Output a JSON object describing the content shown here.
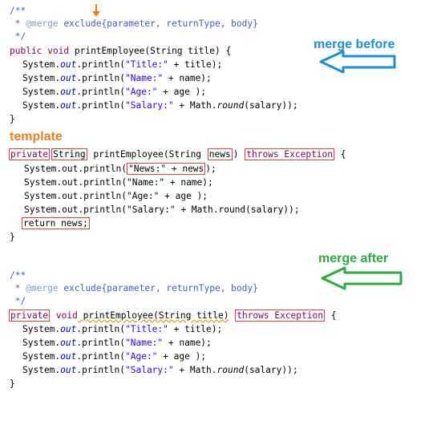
{
  "labels": {
    "merge_before": "merge before",
    "template": "template",
    "merge_after": "merge after"
  },
  "colors": {
    "merge_before": "#1a8fd8",
    "template": "#f07e1a",
    "merge_after": "#2aaa40",
    "box": "#d84040"
  },
  "block1": {
    "doc_open": "/**",
    "doc_line_star": " * ",
    "doc_tag": "@merge",
    "doc_text": " exclude{parameter, returnType, body}",
    "doc_close": " */",
    "sig_public": "public",
    "sig_void": "void",
    "sig_rest": " printEmployee(String title) {",
    "l1_a": "System.",
    "l1_out": "out",
    "l1_b": ".println(",
    "l1_str": "\"Title:\"",
    "l1_c": " + title);",
    "l2_str": "\"Name:\"",
    "l2_c": " + name);",
    "l3_str": "\"Age:\"",
    "l3_c": " + age );",
    "l4_str": "\"Salary:\"",
    "l4_c": " + Math.",
    "l4_round": "round",
    "l4_d": "(salary));",
    "close": "}"
  },
  "block2": {
    "private": "private",
    "string": "String",
    "sig_mid": "printEmployee(String",
    "news": "news",
    "paren": ")",
    "throws": "throws Exception",
    "brace": " {",
    "l1_a": "System.out.println(",
    "l1_box": "\"News:\" + news",
    "l1_c": ");",
    "l2": "System.out.println(\"Name:\" + name);",
    "l3": "System.out.println(\"Age:\" + age );",
    "l4": "System.out.println(\"Salary:\" + Math.round(salary));",
    "ret": "return news;",
    "close": "}"
  },
  "block3": {
    "doc_open": "/**",
    "doc_line_star": " * ",
    "doc_tag": "@merge",
    "doc_text": " exclude{parameter, returnType, body}",
    "doc_close": " */",
    "private": "private",
    "void": "void",
    "sig_mid": " printEmployee(String title)",
    "throws": "throws Exception",
    "brace": " {",
    "l1_a": "System.",
    "l1_out": "out",
    "l1_b": ".println(",
    "l1_str": "\"Title:\"",
    "l1_c": " + title);",
    "l2_str": "\"Name:\"",
    "l2_c": " + name);",
    "l3_str": "\"Age:\"",
    "l3_c": " + age );",
    "l4_str": "\"Salary:\"",
    "l4_c": " + Math.",
    "l4_round": "round",
    "l4_d": "(salary));",
    "close": "}"
  }
}
